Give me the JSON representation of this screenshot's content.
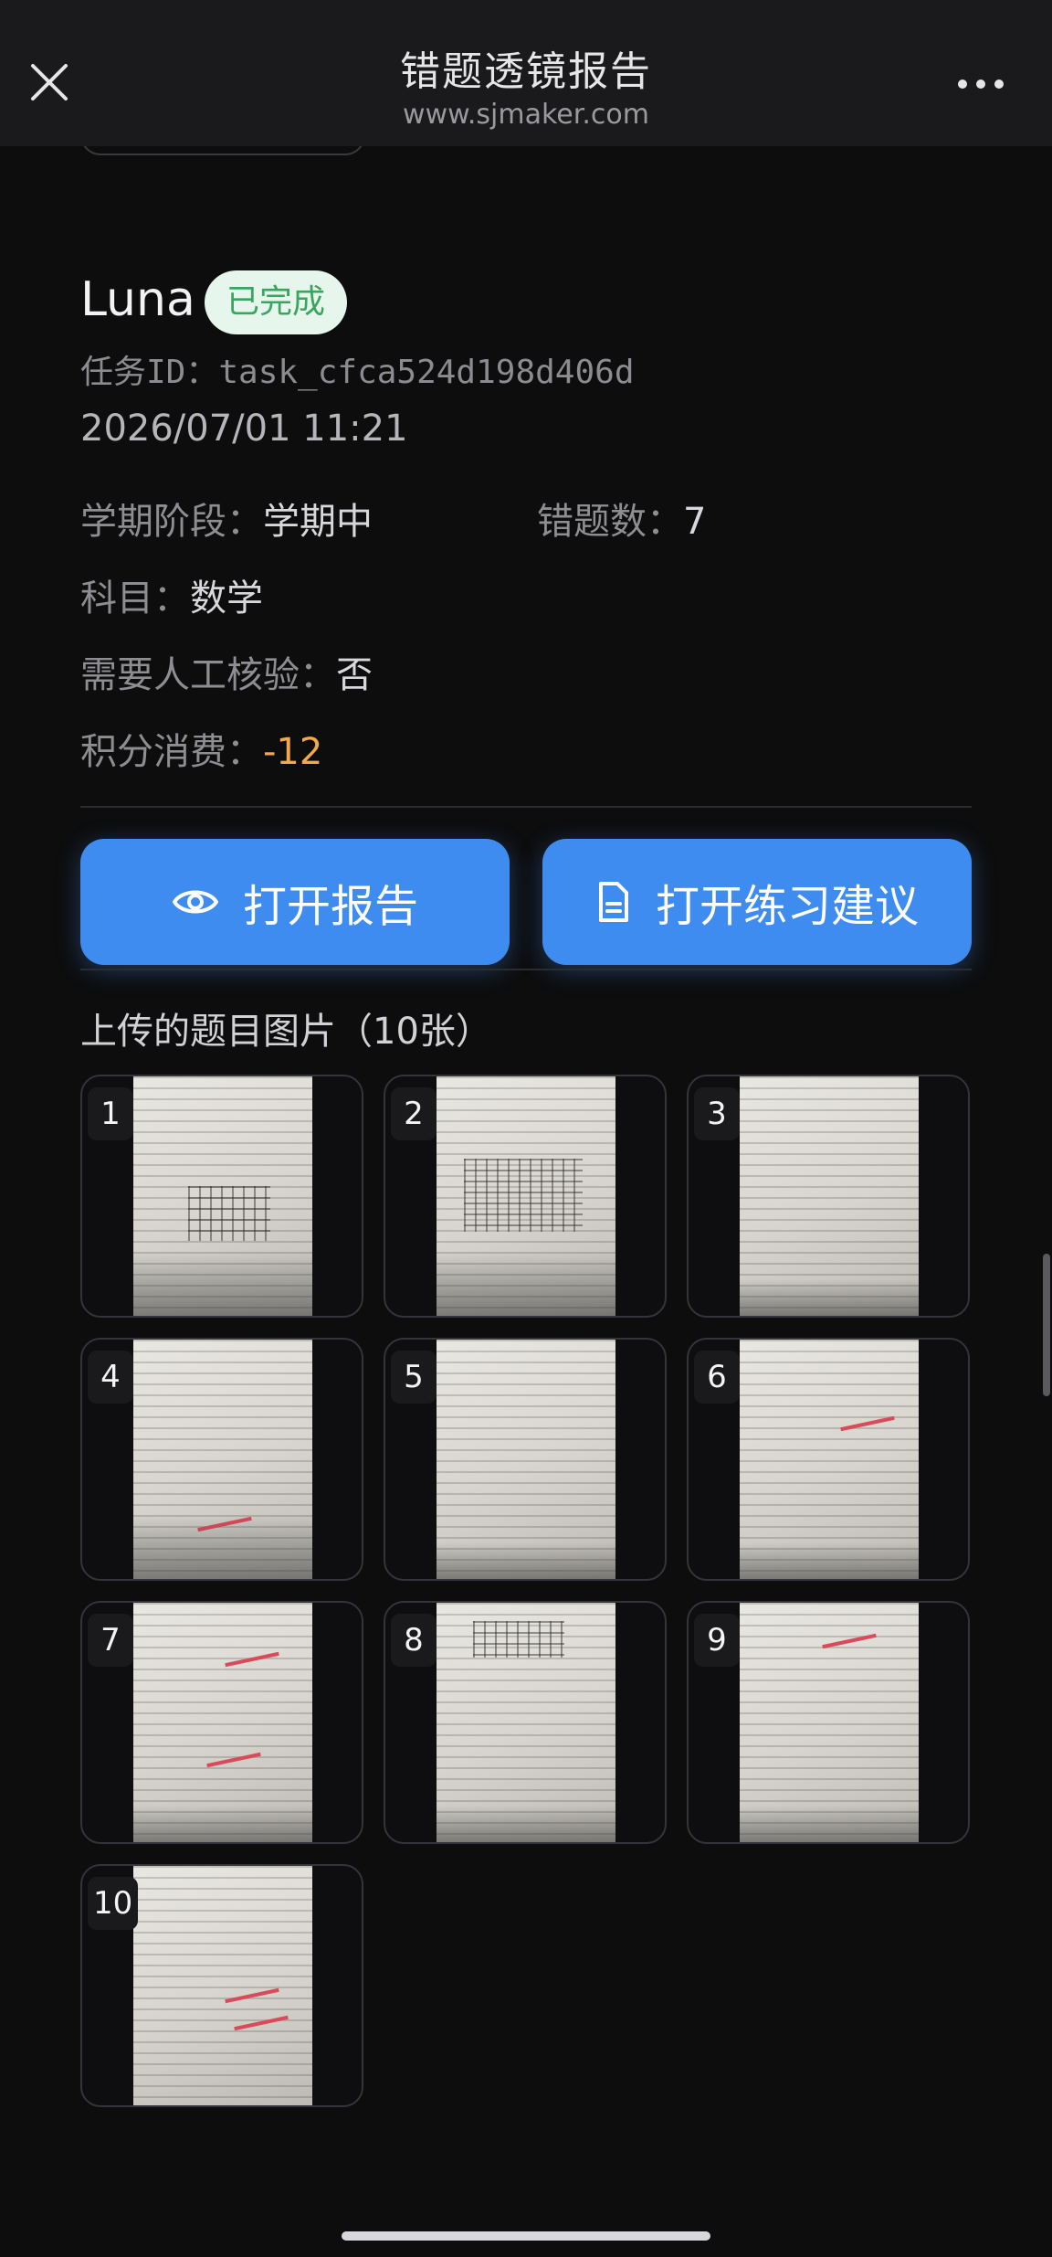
{
  "header": {
    "title": "错题透镜报告",
    "subtitle": "www.sjmaker.com",
    "close_icon": "close-icon",
    "more_icon": "more-icon"
  },
  "task": {
    "name": "Luna",
    "status": "已完成",
    "task_id": "任务ID：task_cfca524d198d406d",
    "timestamp": "2026/07/01 11:21",
    "fields": {
      "semester_label": "学期阶段：",
      "semester_value": "学期中",
      "errors_label": "错题数：",
      "errors_value": "7",
      "subject_label": "科目：",
      "subject_value": "数学",
      "manual_label": "需要人工核验：",
      "manual_value": "否",
      "points_label": "积分消费：",
      "points_value": "-12"
    }
  },
  "actions": {
    "open_report": "打开报告",
    "open_practice": "打开练习建议"
  },
  "images": {
    "section_title": "上传的题目图片（10张）",
    "items": [
      {
        "index": "1"
      },
      {
        "index": "2"
      },
      {
        "index": "3"
      },
      {
        "index": "4"
      },
      {
        "index": "5"
      },
      {
        "index": "6"
      },
      {
        "index": "7"
      },
      {
        "index": "8"
      },
      {
        "index": "9"
      },
      {
        "index": "10"
      }
    ]
  },
  "colors": {
    "accent": "#3f8cf0",
    "status_badge_bg": "#e6f6ec",
    "status_badge_text": "#3aa55e",
    "negative_points": "#f1a94a",
    "background": "#0d0d0e"
  }
}
